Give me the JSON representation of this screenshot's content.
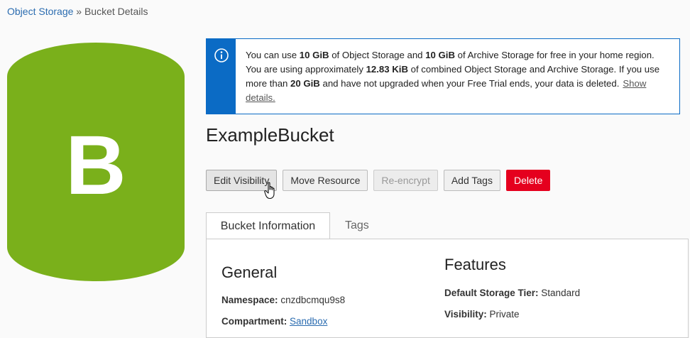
{
  "breadcrumb": {
    "root": "Object Storage",
    "sep": "»",
    "current": "Bucket Details"
  },
  "bucket_icon": {
    "letter": "B",
    "color": "#7ab01b"
  },
  "alert": {
    "icon": "info-icon",
    "t1": "You can use ",
    "b1": "10 GiB",
    "t2": " of Object Storage and ",
    "b2": "10 GiB",
    "t3": " of Archive Storage for free in your home region. You are using approximately ",
    "b3": "12.83 KiB",
    "t4": " of combined Object Storage and Archive Storage. If you use more than ",
    "b4": "20 GiB",
    "t5": " and have not upgraded when your Free Trial ends, your data is deleted.",
    "link": "Show details."
  },
  "title": "ExampleBucket",
  "buttons": {
    "edit_visibility": "Edit Visibility",
    "move_resource": "Move Resource",
    "re_encrypt": "Re-encrypt",
    "add_tags": "Add Tags",
    "delete": "Delete"
  },
  "tabs": {
    "bucket_information": "Bucket Information",
    "tags": "Tags"
  },
  "general": {
    "heading": "General",
    "namespace_label": "Namespace:",
    "namespace_value": "cnzdbcmqu9s8",
    "compartment_label": "Compartment:",
    "compartment_value": "Sandbox"
  },
  "features": {
    "heading": "Features",
    "storage_tier_label": "Default Storage Tier:",
    "storage_tier_value": "Standard",
    "visibility_label": "Visibility:",
    "visibility_value": "Private"
  },
  "colors": {
    "accent": "#0b6bc5",
    "danger": "#e5001e",
    "bucket": "#7ab01b",
    "link": "#2b6cb0"
  }
}
